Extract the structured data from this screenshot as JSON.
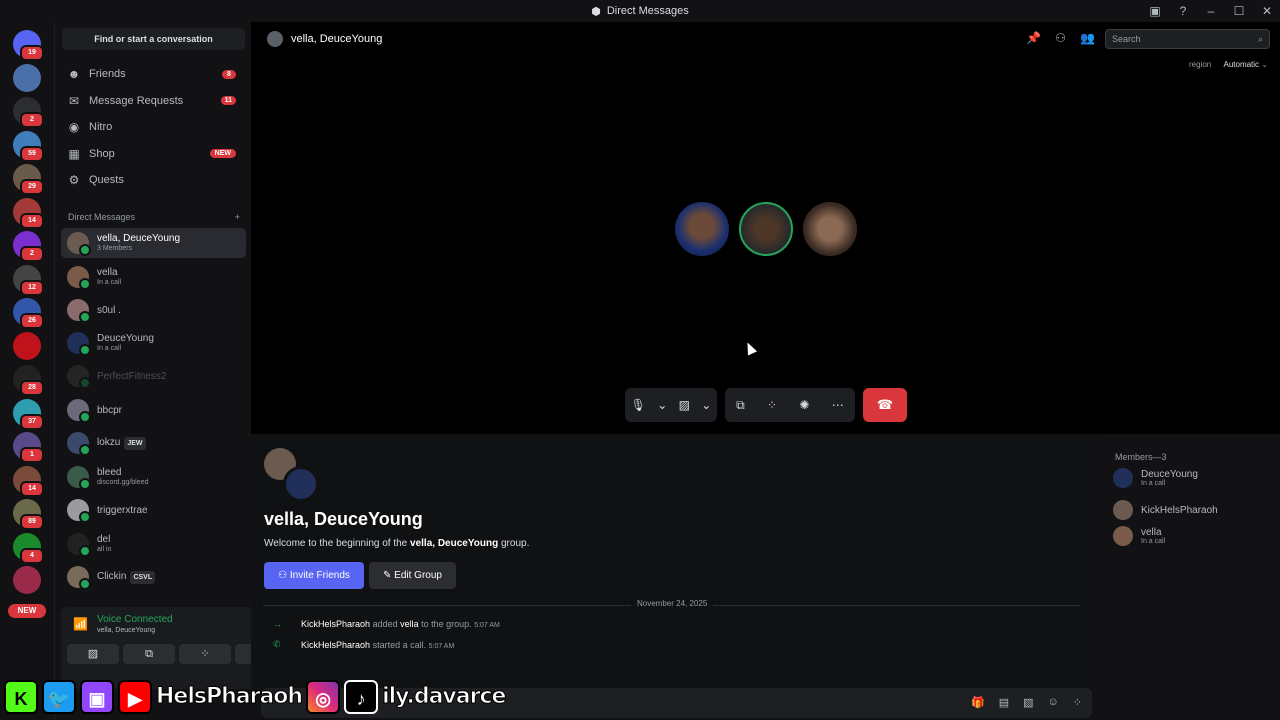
{
  "window": {
    "title": "Direct Messages"
  },
  "rail_badges": [
    "19",
    "",
    "2",
    "59",
    "29",
    "14",
    "2",
    "12",
    "26",
    "",
    "28",
    "37",
    "1",
    "14",
    "89",
    "4",
    ""
  ],
  "rail_new": "NEW",
  "sidebar": {
    "find": "Find or start a conversation",
    "nav": [
      {
        "label": "Friends",
        "count": "8",
        "icon": "friends-icon"
      },
      {
        "label": "Message Requests",
        "count": "11",
        "icon": "message-requests-icon"
      },
      {
        "label": "Nitro",
        "count": "",
        "icon": "nitro-icon"
      },
      {
        "label": "Shop",
        "badge": "NEW",
        "icon": "shop-icon"
      },
      {
        "label": "Quests",
        "count": "",
        "icon": "quests-icon"
      }
    ],
    "dm_header": "Direct Messages",
    "dms": [
      {
        "name": "vella, DeuceYoung",
        "sub": "3 Members",
        "active": true
      },
      {
        "name": "vella",
        "sub": "In a call"
      },
      {
        "name": "s0ul .",
        "sub": ""
      },
      {
        "name": "DeuceYoung",
        "sub": "In a call"
      },
      {
        "name": "PerfectFitness2",
        "sub": ""
      },
      {
        "name": "bbcpr",
        "sub": ""
      },
      {
        "name": "lokzu",
        "sub": "",
        "tag": "JEW"
      },
      {
        "name": "bleed",
        "sub": "discord.gg/bleed"
      },
      {
        "name": "triggerxtrae",
        "sub": ""
      },
      {
        "name": "del",
        "sub": "all in"
      },
      {
        "name": "Clickin",
        "sub": "",
        "tag": "CSVL"
      }
    ],
    "voice": {
      "title": "Voice Connected",
      "sub": "vella, DeuceYoung"
    }
  },
  "header": {
    "title": "vella, DeuceYoung",
    "search_placeholder": "Search",
    "region_label": "region",
    "region_value": "Automatic"
  },
  "group": {
    "title": "vella, DeuceYoung",
    "welcome_prefix": "Welcome to the beginning of the ",
    "welcome_name": "vella, DeuceYoung",
    "welcome_suffix": " group.",
    "invite": "Invite Friends",
    "edit": "Edit Group"
  },
  "date_divider": "November 24, 2025",
  "messages": [
    {
      "who": "KickHelsPharaoh",
      "text_a": "added",
      "target": "vella",
      "text_b": "to the group.",
      "time": "5:07 AM",
      "icon": "join-arrow-icon"
    },
    {
      "who": "KickHelsPharaoh",
      "text_a": "started a call.",
      "target": "",
      "text_b": "",
      "time": "5:07 AM",
      "icon": "phone-icon"
    }
  ],
  "members": {
    "title": "Members—3",
    "list": [
      {
        "name": "DeuceYoung",
        "sub": "In a call"
      },
      {
        "name": "KickHelsPharaoh",
        "sub": ""
      },
      {
        "name": "vella",
        "sub": "In a call"
      }
    ]
  },
  "overlay_text_1": "HelsPharaoh",
  "overlay_text_2": "ily.davarce",
  "colors": {
    "accent": "#5865f2",
    "danger": "#da373c",
    "online": "#23a55a"
  }
}
